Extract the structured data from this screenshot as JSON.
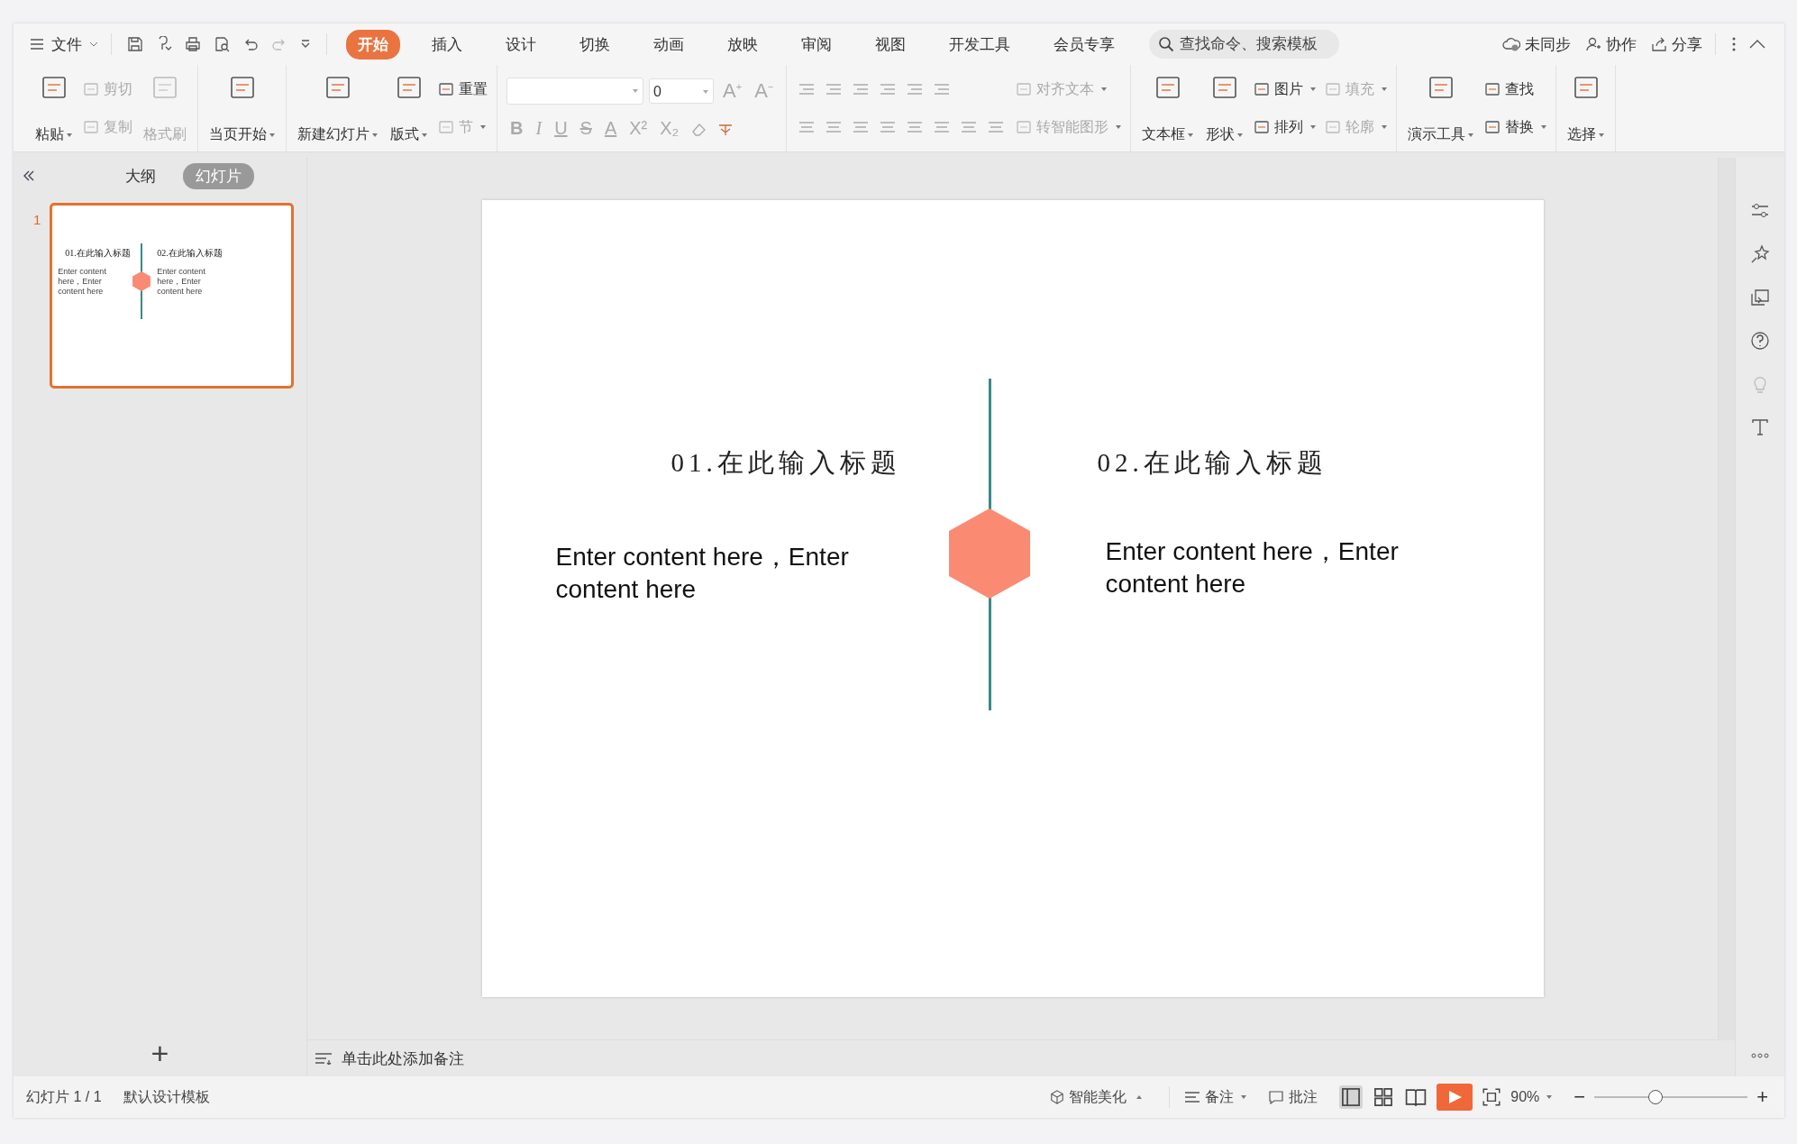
{
  "menu": {
    "label": "文件"
  },
  "tabs": [
    {
      "label": "开始",
      "selected": true
    },
    {
      "label": "插入",
      "selected": false
    },
    {
      "label": "设计",
      "selected": false
    },
    {
      "label": "切换",
      "selected": false
    },
    {
      "label": "动画",
      "selected": false
    },
    {
      "label": "放映",
      "selected": false
    },
    {
      "label": "审阅",
      "selected": false
    },
    {
      "label": "视图",
      "selected": false
    },
    {
      "label": "开发工具",
      "selected": false
    },
    {
      "label": "会员专享",
      "selected": false
    }
  ],
  "search": {
    "placeholder": "查找命令、搜索模板"
  },
  "top_actions": [
    {
      "label": "未同步",
      "kind": "cloud"
    },
    {
      "label": "协作",
      "kind": "person"
    },
    {
      "label": "分享",
      "kind": "share"
    }
  ],
  "ribbon": [
    {
      "columns": [
        {
          "kind": "big",
          "items": [
            {
              "label": "粘贴",
              "caret": true,
              "disabled": false
            }
          ]
        },
        {
          "kind": "small",
          "items": [
            {
              "label": "剪切",
              "caret": false,
              "disabled": true
            },
            {
              "label": "复制",
              "caret": false,
              "disabled": true
            }
          ]
        },
        {
          "kind": "big",
          "items": [
            {
              "label": "格式刷",
              "caret": false,
              "disabled": true
            }
          ]
        }
      ]
    },
    {
      "columns": [
        {
          "kind": "big",
          "items": [
            {
              "label": "当页开始",
              "caret": true,
              "disabled": false
            }
          ]
        }
      ]
    },
    {
      "columns": [
        {
          "kind": "big",
          "items": [
            {
              "label": "新建幻灯片",
              "caret": true,
              "disabled": false
            }
          ]
        },
        {
          "kind": "big",
          "items": [
            {
              "label": "版式",
              "caret": true,
              "disabled": false
            }
          ]
        },
        {
          "kind": "small",
          "items": [
            {
              "label": "重置",
              "caret": false,
              "disabled": false
            },
            {
              "label": "节",
              "caret": true,
              "disabled": true
            }
          ]
        }
      ]
    },
    {
      "font": {
        "size": "0",
        "grow": "A",
        "grow_mark": "+",
        "shrink": "A",
        "shrink_mark": "−",
        "glyphs": [
          "B",
          "I",
          "U",
          "S",
          "A",
          "X²",
          "X₂"
        ]
      }
    },
    {
      "columns": [
        {
          "kind": "small",
          "items": [
            {
              "label": "对齐文本",
              "caret": true,
              "disabled": true
            },
            {
              "label": "转智能图形",
              "caret": true,
              "disabled": true
            }
          ]
        }
      ],
      "paragraph": true
    },
    {
      "columns": [
        {
          "kind": "big",
          "items": [
            {
              "label": "文本框",
              "caret": true,
              "disabled": false
            }
          ]
        },
        {
          "kind": "big",
          "items": [
            {
              "label": "形状",
              "caret": true,
              "disabled": false
            }
          ]
        },
        {
          "kind": "small",
          "items": [
            {
              "label": "图片",
              "caret": true,
              "disabled": false
            },
            {
              "label": "排列",
              "caret": true,
              "disabled": false
            }
          ]
        },
        {
          "kind": "small",
          "items": [
            {
              "label": "填充",
              "caret": true,
              "disabled": true
            },
            {
              "label": "轮廓",
              "caret": true,
              "disabled": true
            }
          ]
        }
      ]
    },
    {
      "columns": [
        {
          "kind": "big",
          "items": [
            {
              "label": "演示工具",
              "caret": true,
              "disabled": false
            }
          ]
        },
        {
          "kind": "small",
          "items": [
            {
              "label": "查找",
              "caret": false,
              "disabled": false
            },
            {
              "label": "替换",
              "caret": true,
              "disabled": false
            }
          ]
        }
      ]
    },
    {
      "columns": [
        {
          "kind": "big",
          "items": [
            {
              "label": "选择",
              "caret": true,
              "disabled": false
            }
          ]
        }
      ]
    }
  ],
  "panel_tabs": [
    {
      "label": "大纲",
      "selected": false
    },
    {
      "label": "幻灯片",
      "selected": true
    }
  ],
  "thumbnail": {
    "number": "1",
    "selected": true,
    "titles": [
      "01.在此输入标题",
      "02.在此输入标题"
    ],
    "bodies": [
      "Enter content here，Enter content here",
      "Enter content here，Enter content here"
    ]
  },
  "add_slide": "+",
  "slide": {
    "titles": [
      "01.在此输入标题",
      "02.在此输入标题"
    ],
    "bodies": [
      "Enter content here，Enter content here",
      "Enter content here，Enter content here"
    ]
  },
  "notes": {
    "placeholder": "单击此处添加备注"
  },
  "status_bar": {
    "slide_counter": "幻灯片 1 / 1",
    "template": "默认设计模板",
    "beautify": "智能美化",
    "notes": "备注",
    "comments": "批注",
    "zoom": "90%",
    "zoom_out": "−",
    "zoom_in": "+",
    "zoom_level": {
      "level": 0.4
    }
  }
}
